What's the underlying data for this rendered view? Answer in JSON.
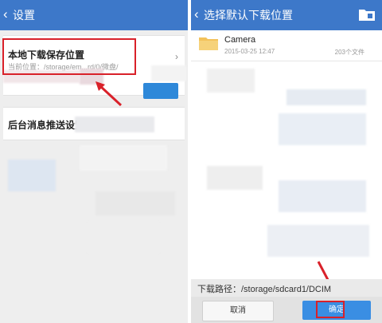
{
  "left": {
    "title": "设置",
    "back_glyph": "‹",
    "download_location": {
      "label": "本地下载保存位置",
      "current": "当前位置：/storage/em...rd/0/微盘/",
      "chevron": "›"
    },
    "push_settings": {
      "label": "后台消息推送设置"
    }
  },
  "right": {
    "title": "选择默认下载位置",
    "back_glyph": "‹",
    "folder": {
      "name": "Camera",
      "date": "2015-03-25 12:47",
      "count": "203个文件"
    },
    "path_label": "下载路径：/storage/sdcard1/DCIM",
    "cancel_label": "取消",
    "ok_label": "确定"
  },
  "colors": {
    "header": "#3d78c9",
    "highlight": "#d9212a",
    "primary_button": "#3a8ee3"
  },
  "icons": [
    "back-icon",
    "chevron-right-icon",
    "folder-icon",
    "new-folder-icon",
    "arrow-icon"
  ]
}
